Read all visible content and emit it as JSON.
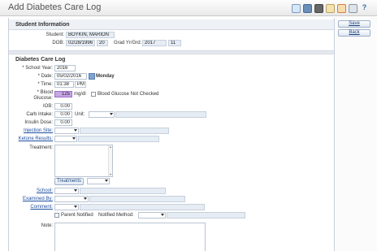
{
  "window": {
    "title": "Add Diabetes Care Log",
    "toolbar_icons": [
      "chart-icon",
      "globe-icon",
      "printer-icon",
      "document-icon",
      "attachment-icon",
      "refresh-icon",
      "help-icon"
    ],
    "help_glyph": "?"
  },
  "actions": {
    "save": "Save",
    "back": "Back"
  },
  "student": {
    "section_title": "Student Information",
    "student_label": "Student:",
    "student_value": "BOYKIN, MARION",
    "dob_label": "DOB:",
    "dob_value": "02/28/1996",
    "age_value": "20",
    "grad_label": "Grad Yr/Grd:",
    "grad_year": "2017",
    "grade": "11"
  },
  "log": {
    "section_title": "Diabetes Care Log",
    "school_year_label": "* School Year:",
    "school_year": "2016",
    "date_label": "* Date:",
    "date": "05/02/2016",
    "weekday": "Monday",
    "time_label": "* Time:",
    "time": "01:38",
    "ampm": "PM",
    "bg_label_1": "* Blood",
    "bg_label_2": "Glucose:",
    "bg_value": "125",
    "bg_unit": "mg/dl",
    "bg_not_checked": "Blood Glucose Not Checked",
    "iob_label": "IOB:",
    "iob_value": "0.00",
    "carb_label": "Carb Intake:",
    "carb_value": "0.00",
    "unit_label": "Unit:",
    "insulin_label": "Insulin Dose:",
    "insulin_value": "0.00",
    "injection_label": "Injection Site:",
    "ketone_label": "Ketone Results:",
    "treatment_label": "Treatment:",
    "treatments_button": "Treatments",
    "school_label": "School:",
    "examined_label": "Examined By:",
    "comment_label": "Comment:",
    "parent_notified": "Parent Notified",
    "notified_method_label": "Notified Method:",
    "note_label": "Note:"
  }
}
